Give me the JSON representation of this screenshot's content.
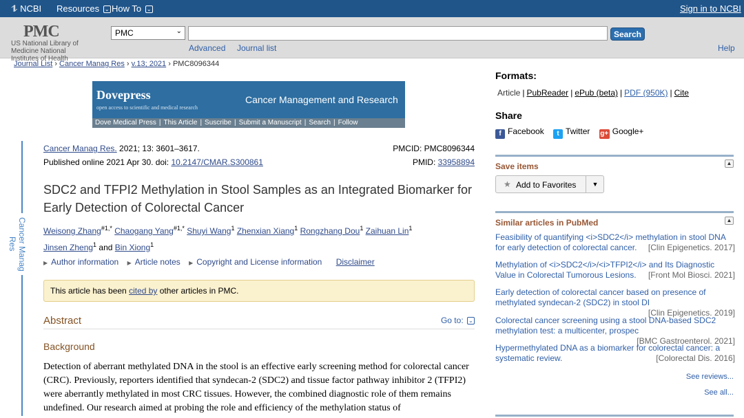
{
  "topbar": {
    "ncbi_label": "NCBI",
    "resources_label": "Resources",
    "howto_label": "How To",
    "signin_label": "Sign in to NCBI"
  },
  "header": {
    "logo_text": "PMC",
    "nlm_text": "US National Library of Medicine National Institutes of Health",
    "db_selected": "PMC",
    "search_value": "",
    "search_button": "Search",
    "advanced_link": "Advanced",
    "journal_list_link": "Journal list",
    "help_link": "Help"
  },
  "breadcrumb": {
    "item1": "Journal List",
    "item2": "Cancer Manag Res",
    "item3": "v.13; 2021",
    "item4": "PMC8096344"
  },
  "banner": {
    "brand": "Dovepress",
    "brand_sub": "open access to scientific and medical research",
    "journal": "Cancer Management and Research",
    "nav": [
      "Dove Medical Press",
      "This Article",
      "Suscribe",
      "Submit a Manuscript",
      "Search",
      "Follow"
    ]
  },
  "side_label": "Cancer Manag Res",
  "citation": {
    "journal_link": "Cancer Manag Res.",
    "details": " 2021; 13: 3601–3617.",
    "published": "Published online 2021 Apr 30. doi: ",
    "doi": "10.2147/CMAR.S300861",
    "pmcid": "PMCID: PMC8096344",
    "pmid_label": "PMID: ",
    "pmid": "33958894"
  },
  "article": {
    "title": "SDC2 and TFPI2 Methylation in Stool Samples as an Integrated Biomarker for Early Detection of Colorectal Cancer",
    "authors": [
      {
        "name": "Weisong Zhang",
        "sup": "#1,*"
      },
      {
        "name": "Chaogang Yang",
        "sup": "#1,*"
      },
      {
        "name": "Shuyi Wang",
        "sup": "1"
      },
      {
        "name": "Zhenxian Xiang",
        "sup": "1"
      },
      {
        "name": "Rongzhang Dou",
        "sup": "1"
      },
      {
        "name": "Zaihuan Lin",
        "sup": "1"
      },
      {
        "name": "Jinsen Zheng",
        "sup": "1"
      },
      {
        "name": "Bin Xiong",
        "sup": "1"
      }
    ],
    "and_word": "and",
    "info_links": [
      "Author information",
      "Article notes",
      "Copyright and License information"
    ],
    "disclaimer": "Disclaimer",
    "cited_pre": "This article has been ",
    "cited_link": "cited by",
    "cited_post": " other articles in PMC.",
    "abstract_heading": "Abstract",
    "goto_label": "Go to:",
    "background_heading": "Background",
    "background_text": "Detection of aberrant methylated DNA in the stool is an effective early screening method for colorectal cancer (CRC). Previously, reporters identified that syndecan-2 (SDC2) and tissue factor pathway inhibitor 2 (TFPI2) were aberrantly methylated in most CRC tissues. However, the combined diagnostic role of them remains undefined. Our research aimed at probing the role and efficiency of the methylation status of"
  },
  "sidebar": {
    "formats_heading": "Formats:",
    "formats": [
      "Article",
      "PubReader",
      "ePub (beta)",
      "PDF (950K)",
      "Cite"
    ],
    "share_heading": "Share",
    "share": [
      {
        "label": "Facebook",
        "color": "#3b5998",
        "glyph": "f"
      },
      {
        "label": "Twitter",
        "color": "#1da1f2",
        "glyph": "t"
      },
      {
        "label": "Google+",
        "color": "#dd4b39",
        "glyph": "g+"
      }
    ],
    "save_heading": "Save items",
    "add_favorites": "Add to Favorites",
    "similar_heading": "Similar articles in PubMed",
    "similar": [
      {
        "title": "Feasibility of quantifying <i>SDC2</i> methylation in stool DNA for early detection of colorectal cancer.",
        "source": "[Clin Epigenetics. 2017]"
      },
      {
        "title": "Methylation of <i>SDC2</i>/<i>TFPI2</i> and Its Diagnostic Value in Colorectal Tumorous Lesions.",
        "source": "[Front Mol Biosci. 2021]"
      },
      {
        "title": "Early detection of colorectal cancer based on presence of methylated syndecan-2 (SDC2) in stool DI",
        "source": "[Clin Epigenetics. 2019]"
      },
      {
        "title": "Colorectal cancer screening using a stool DNA-based SDC2 methylation test: a multicenter, prospec",
        "source": "[BMC Gastroenterol. 2021]"
      },
      {
        "title": "Hypermethylated DNA as a biomarker for colorectal cancer: a systematic review.",
        "source": "[Colorectal Dis. 2016]"
      }
    ],
    "see_reviews": "See reviews...",
    "see_all": "See all..."
  }
}
